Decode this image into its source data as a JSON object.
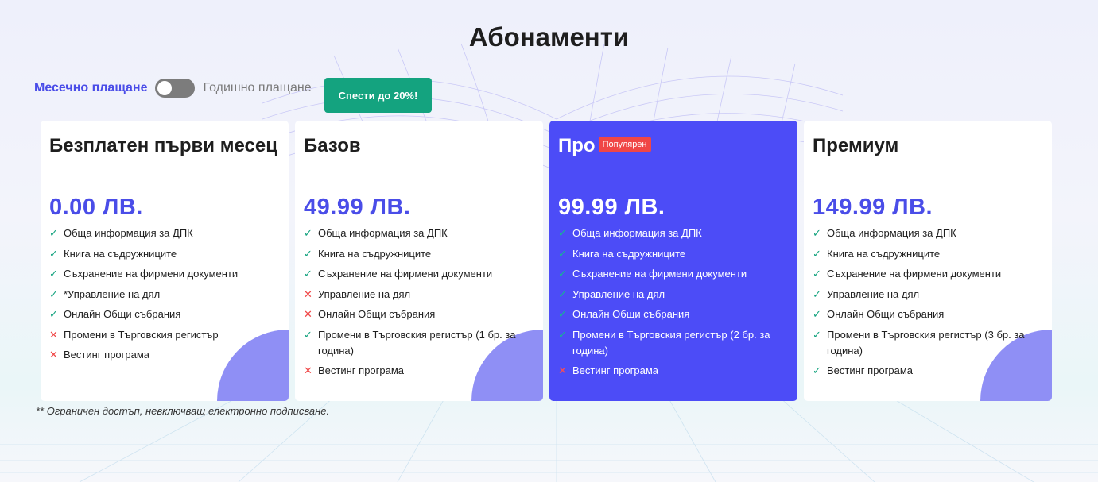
{
  "page": {
    "title": "Абонаменти",
    "billing": {
      "monthly_label": "Месечно плащане",
      "yearly_label": "Годишно плащане",
      "toggle_state": "monthly"
    },
    "save_badge": "Спести до 20%!",
    "footnote": "** Ограничен достъп, невключващ електронно подписване."
  },
  "colors": {
    "accent": "#4a4de8",
    "featured_bg": "#4c4cf7",
    "save_green": "#14a37f",
    "popular_red": "#f04646",
    "decor_purple": "#8f8ff5"
  },
  "icons": {
    "included": "check-icon",
    "excluded": "cross-icon"
  },
  "plans": [
    {
      "name": "Безплатен първи месец",
      "price": "0.00 ЛВ.",
      "features": [
        {
          "text": "Обща информация за ДПК",
          "included": true
        },
        {
          "text": "Книга на съдружниците",
          "included": true
        },
        {
          "text": "Съхранение на фирмени документи",
          "included": true
        },
        {
          "text": "*Управление на дял",
          "included": true
        },
        {
          "text": "Онлайн Общи събрания",
          "included": true
        },
        {
          "text": "Промени в Търговския регистър",
          "included": false
        },
        {
          "text": "Вестинг програма",
          "included": false
        }
      ]
    },
    {
      "name": "Базов",
      "price": "49.99 ЛВ.",
      "features": [
        {
          "text": "Обща информация за ДПК",
          "included": true
        },
        {
          "text": "Книга на съдружниците",
          "included": true
        },
        {
          "text": "Съхранение на фирмени документи",
          "included": true
        },
        {
          "text": "Управление на дял",
          "included": false
        },
        {
          "text": "Онлайн Общи събрания",
          "included": false
        },
        {
          "text": "Промени в Търговския регистър (1 бр. за година)",
          "included": true
        },
        {
          "text": "Вестинг програма",
          "included": false
        }
      ]
    },
    {
      "name": "Про",
      "badge": "Популярен",
      "price": "99.99 ЛВ.",
      "features": [
        {
          "text": "Обща информация за ДПК",
          "included": true
        },
        {
          "text": "Книга на съдружниците",
          "included": true
        },
        {
          "text": "Съхранение на фирмени документи",
          "included": true
        },
        {
          "text": "Управление на дял",
          "included": true
        },
        {
          "text": "Онлайн Общи събрания",
          "included": true
        },
        {
          "text": "Промени в Търговския регистър (2 бр. за година)",
          "included": true
        },
        {
          "text": "Вестинг програма",
          "included": false
        }
      ]
    },
    {
      "name": "Премиум",
      "price": "149.99 ЛВ.",
      "features": [
        {
          "text": "Обща информация за ДПК",
          "included": true
        },
        {
          "text": "Книга на съдружниците",
          "included": true
        },
        {
          "text": "Съхранение на фирмени документи",
          "included": true
        },
        {
          "text": "Управление на дял",
          "included": true
        },
        {
          "text": "Онлайн Общи събрания",
          "included": true
        },
        {
          "text": "Промени в Търговския регистър (3 бр. за година)",
          "included": true
        },
        {
          "text": "Вестинг програма",
          "included": true
        }
      ]
    }
  ]
}
